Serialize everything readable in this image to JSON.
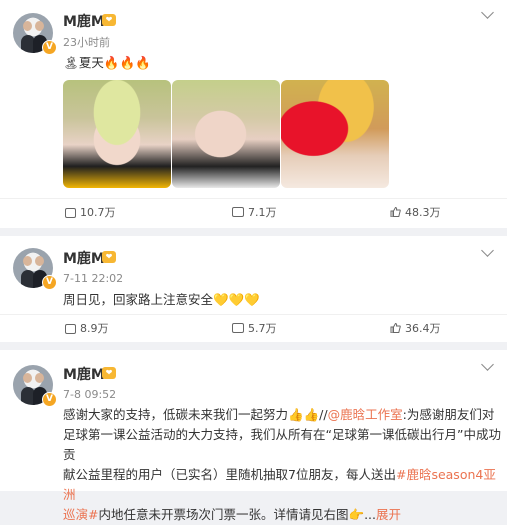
{
  "posts": [
    {
      "username": "M鹿M",
      "time": "23小时前",
      "text_emoji": "🏝",
      "text": "夏天",
      "fires": "🔥🔥🔥",
      "stats": {
        "share": "10.7万",
        "comment": "7.1万",
        "like": "48.3万"
      }
    },
    {
      "username": "M鹿M",
      "time": "7-11 22:02",
      "text": "周日见，回家路上注意安全",
      "hearts": "💛💛💛",
      "stats": {
        "share": "8.9万",
        "comment": "5.7万",
        "like": "36.4万"
      }
    },
    {
      "username": "M鹿M",
      "time": "7-8 09:52",
      "line1_a": "感谢大家的支持，低碳未来我们一起努力",
      "line1_emoji": "👍👍",
      "line1_b": "//",
      "line1_link": "@鹿晗工作室",
      "line1_c": ":为感谢朋友们对",
      "line2": "足球第一课公益活动的大力支持，我们从所有在“足球第一课低碳出行月”中成功贡",
      "line3": "献公益里程的用户（已实名）里随机抽取7位朋友，每人送出",
      "line3_link": "#鹿晗season4亚洲",
      "line4_link": "巡演#",
      "line4_text": "内地任意未开票场次门票一张。详情请见右图",
      "line4_emoji": "👉...",
      "expand": "展开"
    }
  ],
  "colors": {
    "accent": "#eb7350",
    "badge": "#f5a623",
    "background": "#f0f1f4"
  },
  "icons": [
    "share-icon",
    "comment-icon",
    "like-icon",
    "chevron-down-icon",
    "verified-badge-icon"
  ]
}
